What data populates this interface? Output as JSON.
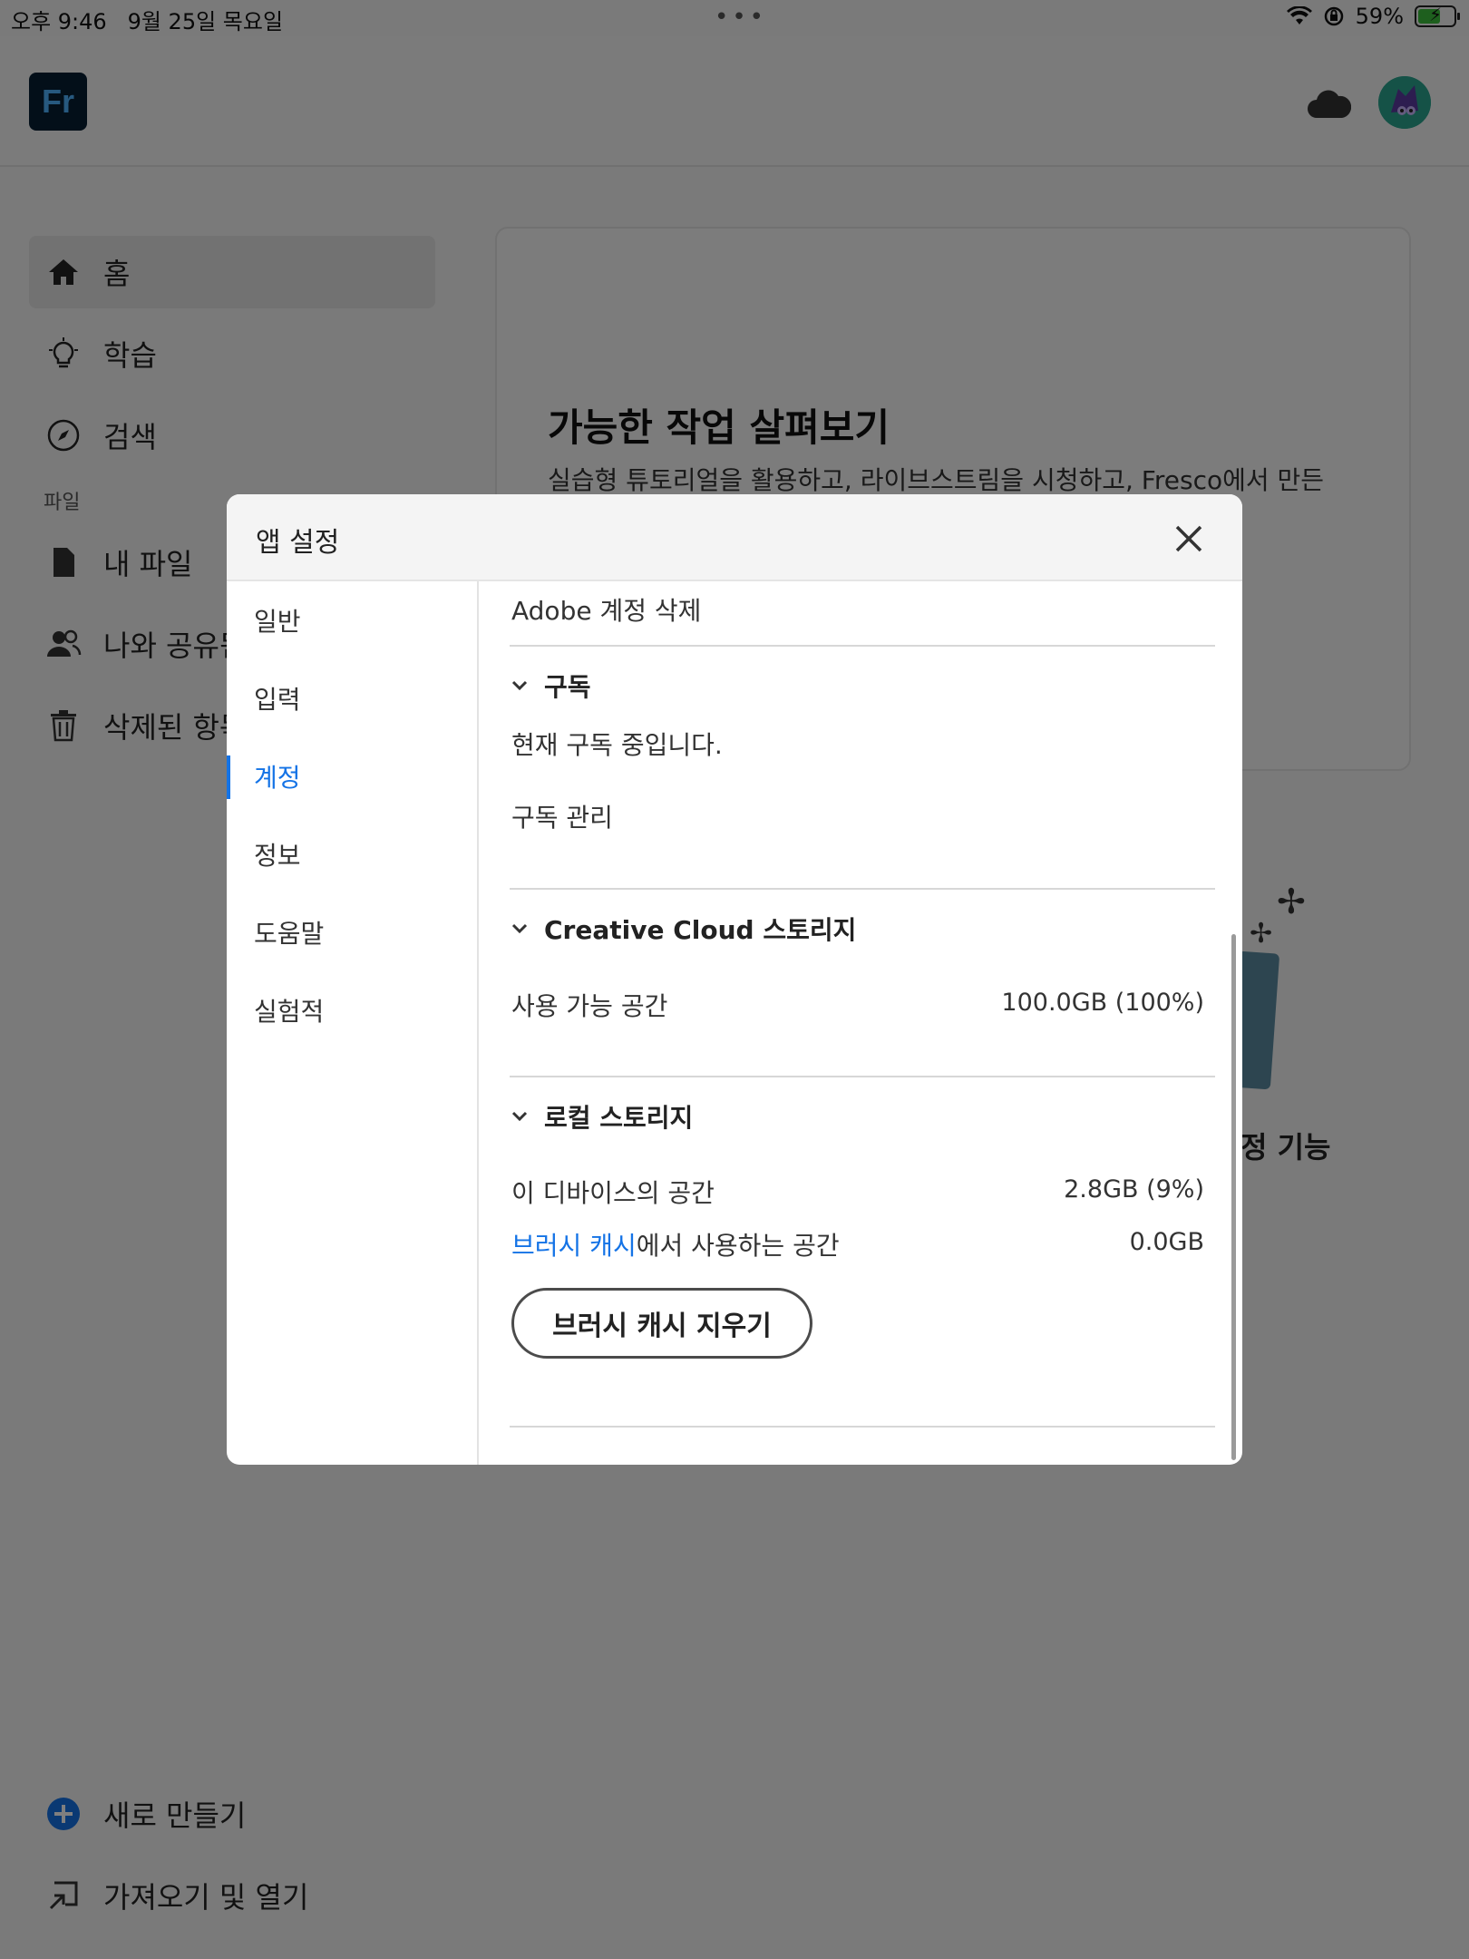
{
  "status_bar": {
    "time": "오후 9:46",
    "date": "9월 25일 목요일",
    "battery": "59%",
    "battery_level": 0.59
  },
  "header": {
    "app_logo": "Fr"
  },
  "sidebar": {
    "items": [
      {
        "label": "홈",
        "icon": "home-icon"
      },
      {
        "label": "학습",
        "icon": "lightbulb-icon"
      },
      {
        "label": "검색",
        "icon": "compass-icon"
      }
    ],
    "files_label": "파일",
    "file_items": [
      {
        "label": "내 파일",
        "icon": "file-icon"
      },
      {
        "label": "나와 공유됨",
        "icon": "people-icon"
      },
      {
        "label": "삭제된 항목",
        "icon": "trash-icon"
      }
    ],
    "bottom_items": [
      {
        "label": "새로 만들기",
        "icon": "plus-circle-icon"
      },
      {
        "label": "가져오기 및 열기",
        "icon": "import-icon"
      }
    ]
  },
  "main": {
    "card_title": "가능한 작업 살펴보기",
    "card_desc": "실습형 튜토리얼을 활용하고, 라이브스트림을 시청하고, Fresco에서 만든",
    "feature_caption": "정 기능"
  },
  "dialog": {
    "title": "앱 설정",
    "nav": [
      "일반",
      "입력",
      "계정",
      "정보",
      "도움말",
      "실험적"
    ],
    "active_nav": "계정",
    "delete_account": "Adobe 계정 삭제",
    "subscription": {
      "title": "구독",
      "status": "현재 구독 중입니다.",
      "manage": "구독 관리"
    },
    "cc_storage": {
      "title": "Creative Cloud 스토리지",
      "available_label": "사용 가능 공간",
      "available_value": "100.0GB (100%)"
    },
    "local_storage": {
      "title": "로컬 스토리지",
      "device_label": "이 디바이스의 공간",
      "device_value": "2.8GB (9%)",
      "cache_link": "브러시 캐시",
      "cache_suffix": "에서 사용하는 공간",
      "cache_value": "0.0GB",
      "clear_button": "브러시 캐시 지우기"
    }
  },
  "colors": {
    "accent": "#1473e6",
    "logo_bg": "#061e33",
    "logo_text": "#4fb3ff",
    "battery_green": "#3cbf3c"
  }
}
